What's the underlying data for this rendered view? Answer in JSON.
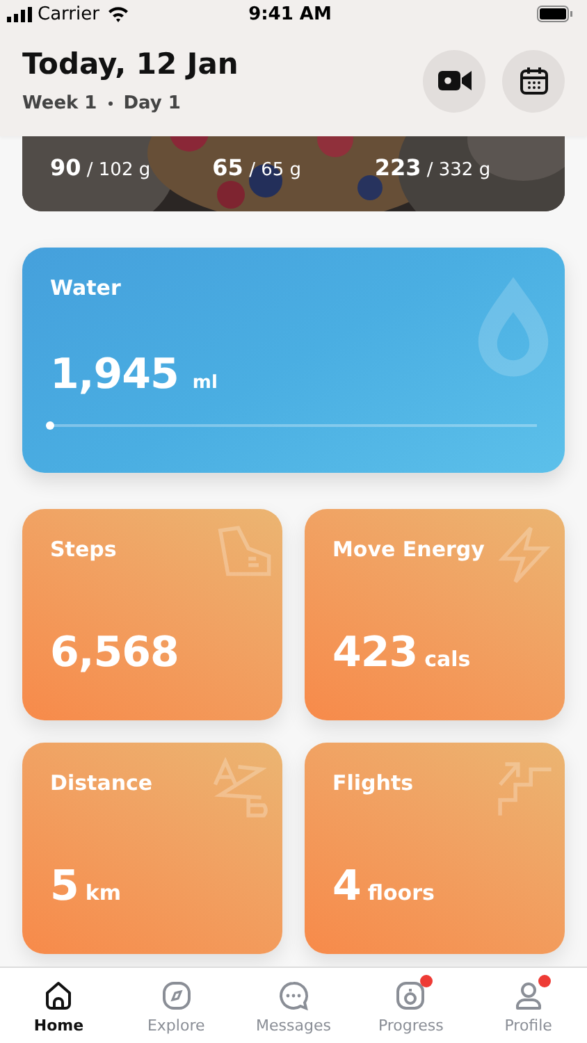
{
  "status_bar": {
    "carrier": "Carrier",
    "time": "9:41 AM"
  },
  "header": {
    "title": "Today, 12 Jan",
    "week": "Week 1",
    "day": "Day 1"
  },
  "macros": [
    {
      "value": "90",
      "target": "/ 102 g"
    },
    {
      "value": "65",
      "target": "/ 65 g"
    },
    {
      "value": "223",
      "target": "/ 332 g"
    }
  ],
  "water": {
    "title": "Water",
    "value": "1,945",
    "unit": "ml",
    "level": 0
  },
  "stats": [
    {
      "kind": "steps",
      "title": "Steps",
      "value": "6,568"
    },
    {
      "kind": "energy",
      "title": "Move Energy",
      "value": "423",
      "unit": "cals"
    },
    {
      "kind": "distance",
      "title": "Distance",
      "value": "5",
      "unit": "km"
    },
    {
      "kind": "flights",
      "title": "Flights",
      "value": "4",
      "unit": "floors"
    }
  ],
  "tabs": [
    {
      "kind": "home",
      "label": "Home",
      "selected": true,
      "badge": false
    },
    {
      "kind": "explore",
      "label": "Explore",
      "selected": false,
      "badge": false
    },
    {
      "kind": "messages",
      "label": "Messages",
      "selected": false,
      "badge": false
    },
    {
      "kind": "progress",
      "label": "Progress",
      "selected": false,
      "badge": true
    },
    {
      "kind": "profile",
      "label": "Profile",
      "selected": false,
      "badge": true
    }
  ]
}
